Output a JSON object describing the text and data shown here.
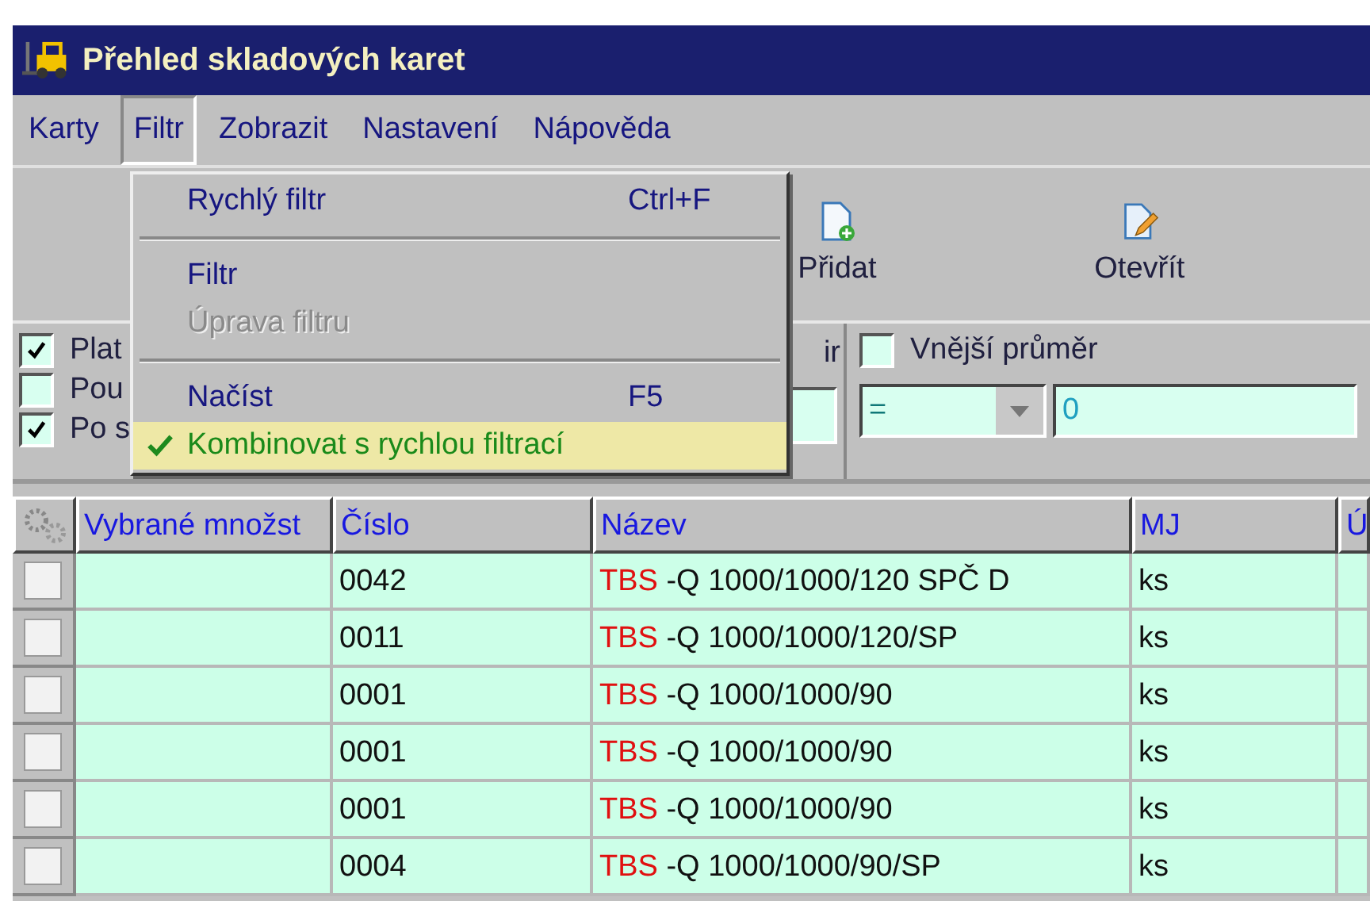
{
  "window": {
    "title": "Přehled skladových karet"
  },
  "menu_bar": [
    {
      "label": "Karty",
      "selected": false
    },
    {
      "label": "Filtr",
      "selected": true
    },
    {
      "label": "Zobrazit",
      "selected": false
    },
    {
      "label": "Nastavení",
      "selected": false
    },
    {
      "label": "Nápověda",
      "selected": false
    }
  ],
  "toolbar": [
    {
      "label": "Přidat",
      "kind": "add"
    },
    {
      "label": "Otevřít",
      "kind": "edit"
    }
  ],
  "filters": {
    "left": [
      {
        "label": "Plat",
        "checked": true
      },
      {
        "label": "Pou",
        "checked": false
      },
      {
        "label": "Po s",
        "checked": true
      }
    ],
    "middle_label": "ir",
    "right": {
      "label": "Vnější průměr",
      "checked": false,
      "operator": "=",
      "value": "0"
    }
  },
  "dropdown_menu": [
    {
      "kind": "item",
      "label": "Rychlý filtr",
      "shortcut": "Ctrl+F",
      "disabled": false,
      "checked": false,
      "selected": false
    },
    {
      "kind": "separator"
    },
    {
      "kind": "item",
      "label": "Filtr",
      "disabled": false,
      "checked": false,
      "selected": false
    },
    {
      "kind": "item",
      "label": "Úprava filtru",
      "disabled": true,
      "checked": false,
      "selected": false
    },
    {
      "kind": "separator"
    },
    {
      "kind": "item",
      "label": "Načíst",
      "shortcut": "F5",
      "disabled": false,
      "checked": false,
      "selected": false
    },
    {
      "kind": "item",
      "label": "Kombinovat s rychlou filtrací",
      "disabled": false,
      "checked": true,
      "selected": true
    }
  ],
  "table": {
    "columns": [
      "Vybrané množst",
      "Číslo",
      "Název",
      "MJ",
      "Ú"
    ],
    "rows": [
      {
        "checked": false,
        "cells": [
          "",
          "0042",
          {
            "prefix": "TBS",
            "rest": "-Q 1000/1000/120 SPČ D"
          },
          "ks",
          ""
        ]
      },
      {
        "checked": false,
        "cells": [
          "",
          "0011",
          {
            "prefix": "TBS",
            "rest": "-Q 1000/1000/120/SP"
          },
          "ks",
          ""
        ]
      },
      {
        "checked": false,
        "cells": [
          "",
          "0001",
          {
            "prefix": "TBS",
            "rest": "-Q 1000/1000/90"
          },
          "ks",
          ""
        ]
      },
      {
        "checked": false,
        "cells": [
          "",
          "0001",
          {
            "prefix": "TBS",
            "rest": "-Q 1000/1000/90"
          },
          "ks",
          ""
        ]
      },
      {
        "checked": false,
        "cells": [
          "",
          "0001",
          {
            "prefix": "TBS",
            "rest": "-Q 1000/1000/90"
          },
          "ks",
          ""
        ]
      },
      {
        "checked": false,
        "cells": [
          "",
          "0004",
          {
            "prefix": "TBS",
            "rest": "-Q 1000/1000/90/SP"
          },
          "ks",
          ""
        ]
      }
    ]
  }
}
